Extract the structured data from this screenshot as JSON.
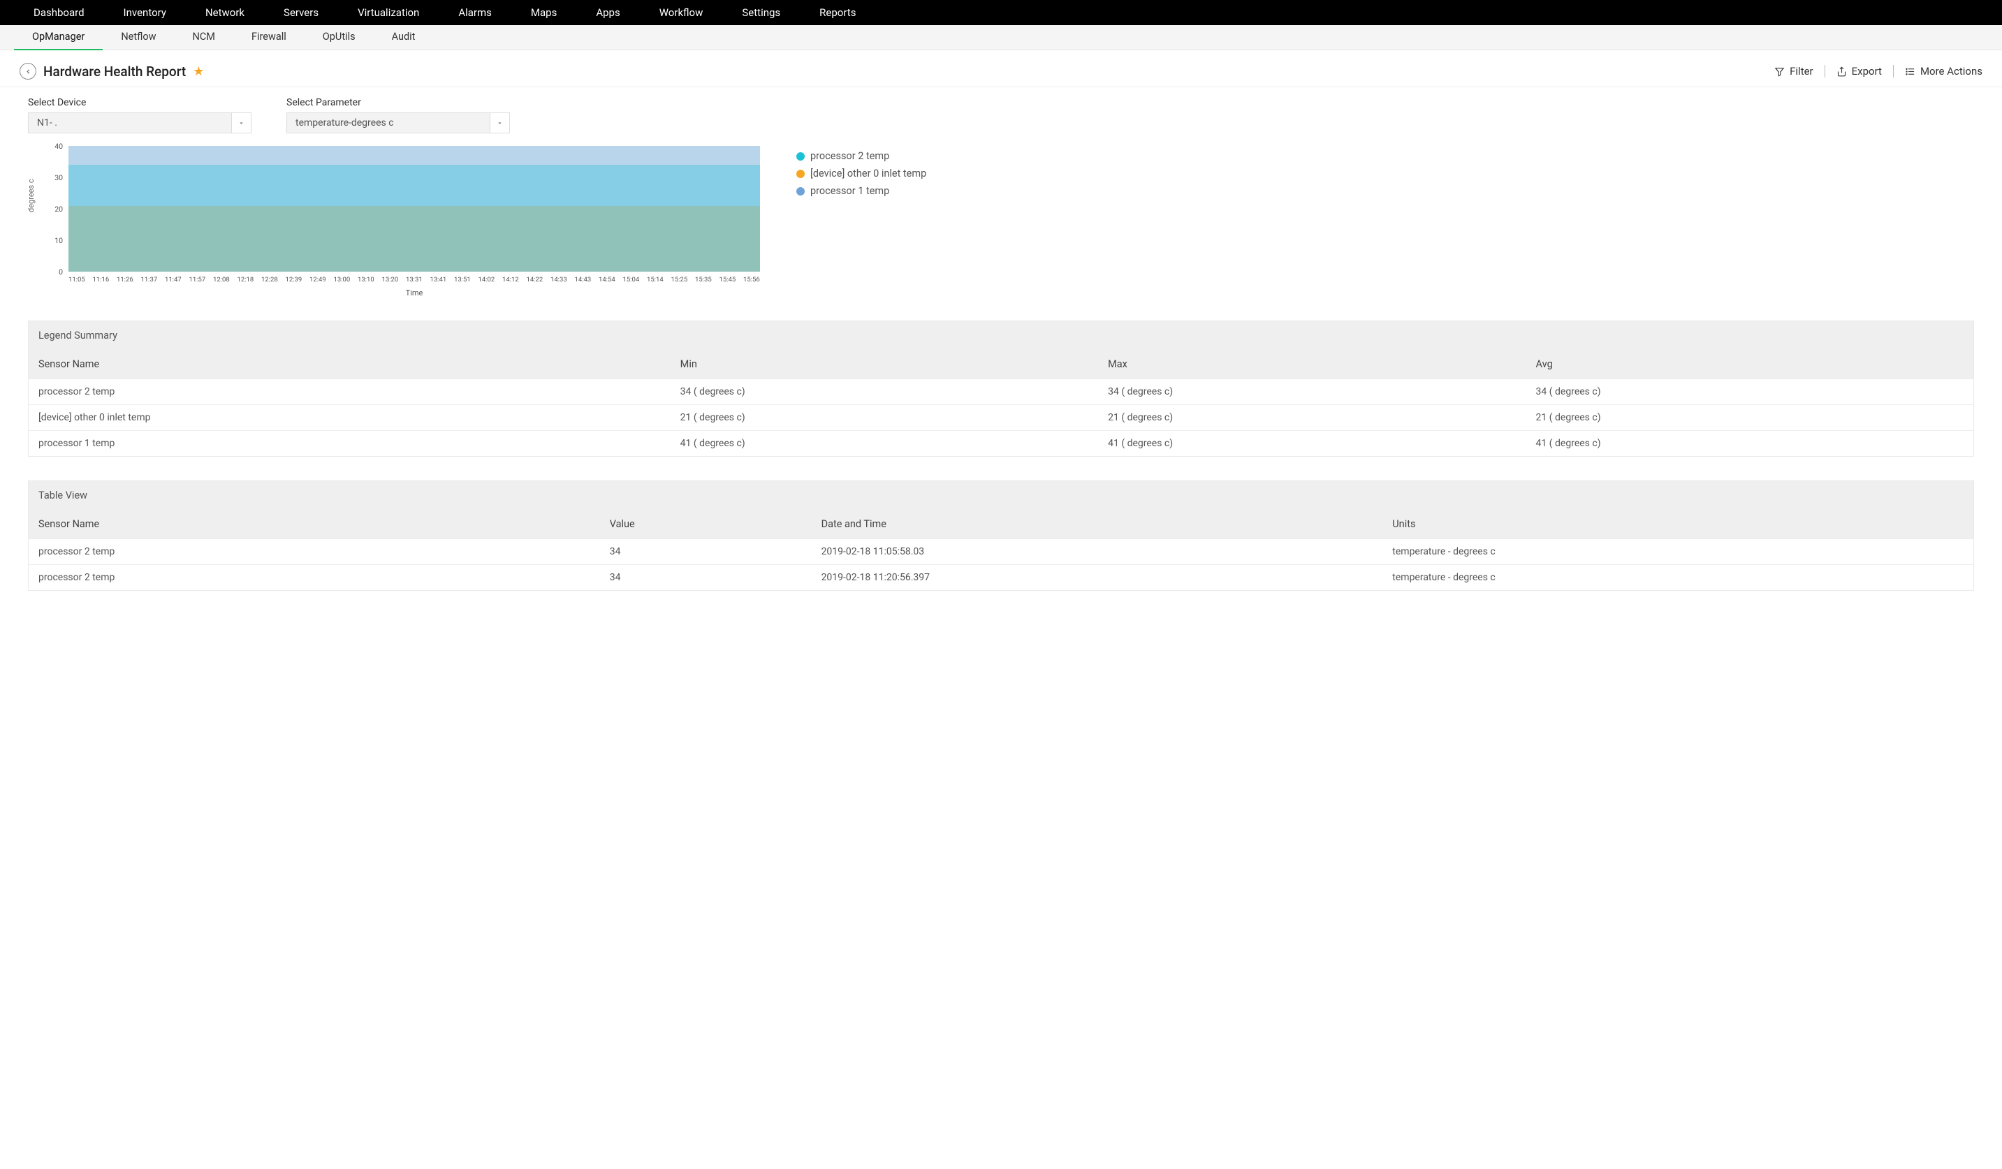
{
  "topnav": [
    "Dashboard",
    "Inventory",
    "Network",
    "Servers",
    "Virtualization",
    "Alarms",
    "Maps",
    "Apps",
    "Workflow",
    "Settings",
    "Reports"
  ],
  "subnav": [
    "OpManager",
    "Netflow",
    "NCM",
    "Firewall",
    "OpUtils",
    "Audit"
  ],
  "subnav_active_index": 0,
  "page_title": "Hardware Health Report",
  "header_actions": {
    "filter": "Filter",
    "export": "Export",
    "more": "More Actions"
  },
  "selectors": {
    "device_label": "Select Device",
    "device_value": "N1-            .",
    "param_label": "Select Parameter",
    "param_value": "temperature-degrees c"
  },
  "chart_data": {
    "type": "area",
    "xlabel": "Time",
    "ylabel": "degrees c",
    "ylim": [
      0,
      40
    ],
    "yticks": [
      0,
      10,
      20,
      30,
      40
    ],
    "categories": [
      "11:05",
      "11:16",
      "11:26",
      "11:37",
      "11:47",
      "11:57",
      "12:08",
      "12:18",
      "12:28",
      "12:39",
      "12:49",
      "13:00",
      "13:10",
      "13:20",
      "13:31",
      "13:41",
      "13:51",
      "14:02",
      "14:12",
      "14:22",
      "14:33",
      "14:43",
      "14:54",
      "15:04",
      "15:14",
      "15:25",
      "15:35",
      "15:45",
      "15:56"
    ],
    "series": [
      {
        "name": "processor 2 temp",
        "color": "#1bc1d6",
        "value": 34
      },
      {
        "name": "[device] other 0 inlet temp",
        "color": "#f6a623",
        "value": 21
      },
      {
        "name": "processor 1 temp",
        "color": "#6fa3d8",
        "value": 41
      }
    ]
  },
  "legend_summary_title": "Legend Summary",
  "legend_summary_headers": [
    "Sensor Name",
    "Min",
    "Max",
    "Avg"
  ],
  "legend_summary_rows": [
    {
      "name": "processor 2 temp",
      "min": "34 ( degrees c)",
      "max": "34 ( degrees c)",
      "avg": "34 ( degrees c)"
    },
    {
      "name": "[device] other 0 inlet temp",
      "min": "21 ( degrees c)",
      "max": "21 ( degrees c)",
      "avg": "21 ( degrees c)"
    },
    {
      "name": "processor 1 temp",
      "min": "41 ( degrees c)",
      "max": "41 ( degrees c)",
      "avg": "41 ( degrees c)"
    }
  ],
  "table_view_title": "Table View",
  "table_view_headers": [
    "Sensor Name",
    "Value",
    "Date and Time",
    "Units"
  ],
  "table_view_rows": [
    {
      "name": "processor 2 temp",
      "value": "34",
      "dt": "2019-02-18 11:05:58.03",
      "units": "temperature - degrees c"
    },
    {
      "name": "processor 2 temp",
      "value": "34",
      "dt": "2019-02-18 11:20:56.397",
      "units": "temperature - degrees c"
    }
  ]
}
